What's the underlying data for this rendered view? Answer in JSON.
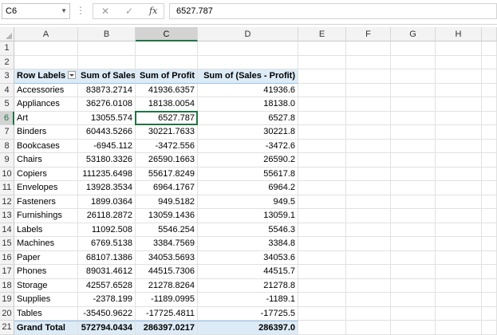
{
  "formula_bar": {
    "name_box": "C6",
    "cancel_icon": "✕",
    "confirm_icon": "✓",
    "fx_label": "fx",
    "formula_value": "6527.787"
  },
  "columns": [
    "A",
    "B",
    "C",
    "D",
    "E",
    "F",
    "G",
    "H"
  ],
  "selected_column": "C",
  "selected_row": "6",
  "row_numbers": [
    "1",
    "2",
    "3",
    "4",
    "5",
    "6",
    "7",
    "8",
    "9",
    "10",
    "11",
    "12",
    "13",
    "14",
    "15",
    "16",
    "17",
    "18",
    "19",
    "20",
    "21"
  ],
  "pivot": {
    "headers": [
      "Row Labels",
      "Sum of Sales",
      "Sum of Profit",
      "Sum of (Sales - Profit)"
    ],
    "rows": [
      [
        "Accessories",
        "83873.2714",
        "41936.6357",
        "41936.6"
      ],
      [
        "Appliances",
        "36276.0108",
        "18138.0054",
        "18138.0"
      ],
      [
        "Art",
        "13055.574",
        "6527.787",
        "6527.8"
      ],
      [
        "Binders",
        "60443.5266",
        "30221.7633",
        "30221.8"
      ],
      [
        "Bookcases",
        "-6945.112",
        "-3472.556",
        "-3472.6"
      ],
      [
        "Chairs",
        "53180.3326",
        "26590.1663",
        "26590.2"
      ],
      [
        "Copiers",
        "111235.6498",
        "55617.8249",
        "55617.8"
      ],
      [
        "Envelopes",
        "13928.3534",
        "6964.1767",
        "6964.2"
      ],
      [
        "Fasteners",
        "1899.0364",
        "949.5182",
        "949.5"
      ],
      [
        "Furnishings",
        "26118.2872",
        "13059.1436",
        "13059.1"
      ],
      [
        "Labels",
        "11092.508",
        "5546.254",
        "5546.3"
      ],
      [
        "Machines",
        "6769.5138",
        "3384.7569",
        "3384.8"
      ],
      [
        "Paper",
        "68107.1386",
        "34053.5693",
        "34053.6"
      ],
      [
        "Phones",
        "89031.4612",
        "44515.7306",
        "44515.7"
      ],
      [
        "Storage",
        "42557.6528",
        "21278.8264",
        "21278.8"
      ],
      [
        "Supplies",
        "-2378.199",
        "-1189.0995",
        "-1189.1"
      ],
      [
        "Tables",
        "-35450.9622",
        "-17725.4811",
        "-17725.5"
      ]
    ],
    "total": [
      "Grand Total",
      "572794.0434",
      "286397.0217",
      "286397.0"
    ]
  }
}
